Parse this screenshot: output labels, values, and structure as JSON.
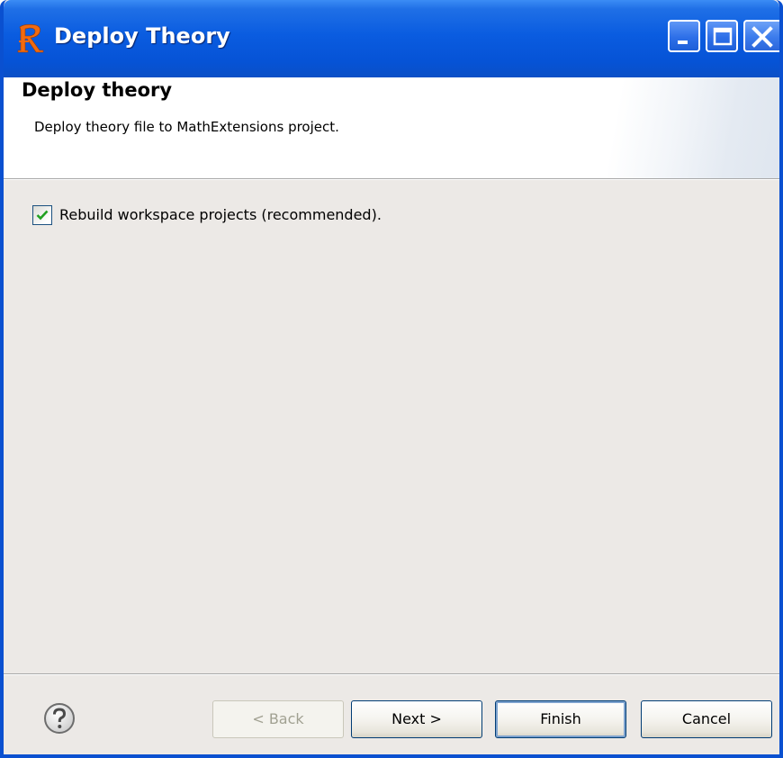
{
  "window": {
    "title": "Deploy Theory",
    "icon": "app-r-logo-icon",
    "controls": [
      "minimize-icon",
      "maximize-icon",
      "close-icon"
    ]
  },
  "banner": {
    "title": "Deploy theory",
    "description": "Deploy theory file to MathExtensions project."
  },
  "options": {
    "rebuild": {
      "label": "Rebuild workspace projects (recommended).",
      "checked": true
    }
  },
  "buttons": {
    "back": "< Back",
    "next": "Next >",
    "finish": "Finish",
    "cancel": "Cancel",
    "back_enabled": false
  },
  "colors": {
    "titlebar": "#0a5ce0",
    "frame": "#0a50d0",
    "dialog_bg": "#ece9e6",
    "check_green": "#21a121",
    "icon_orange": "#f06a0f"
  }
}
